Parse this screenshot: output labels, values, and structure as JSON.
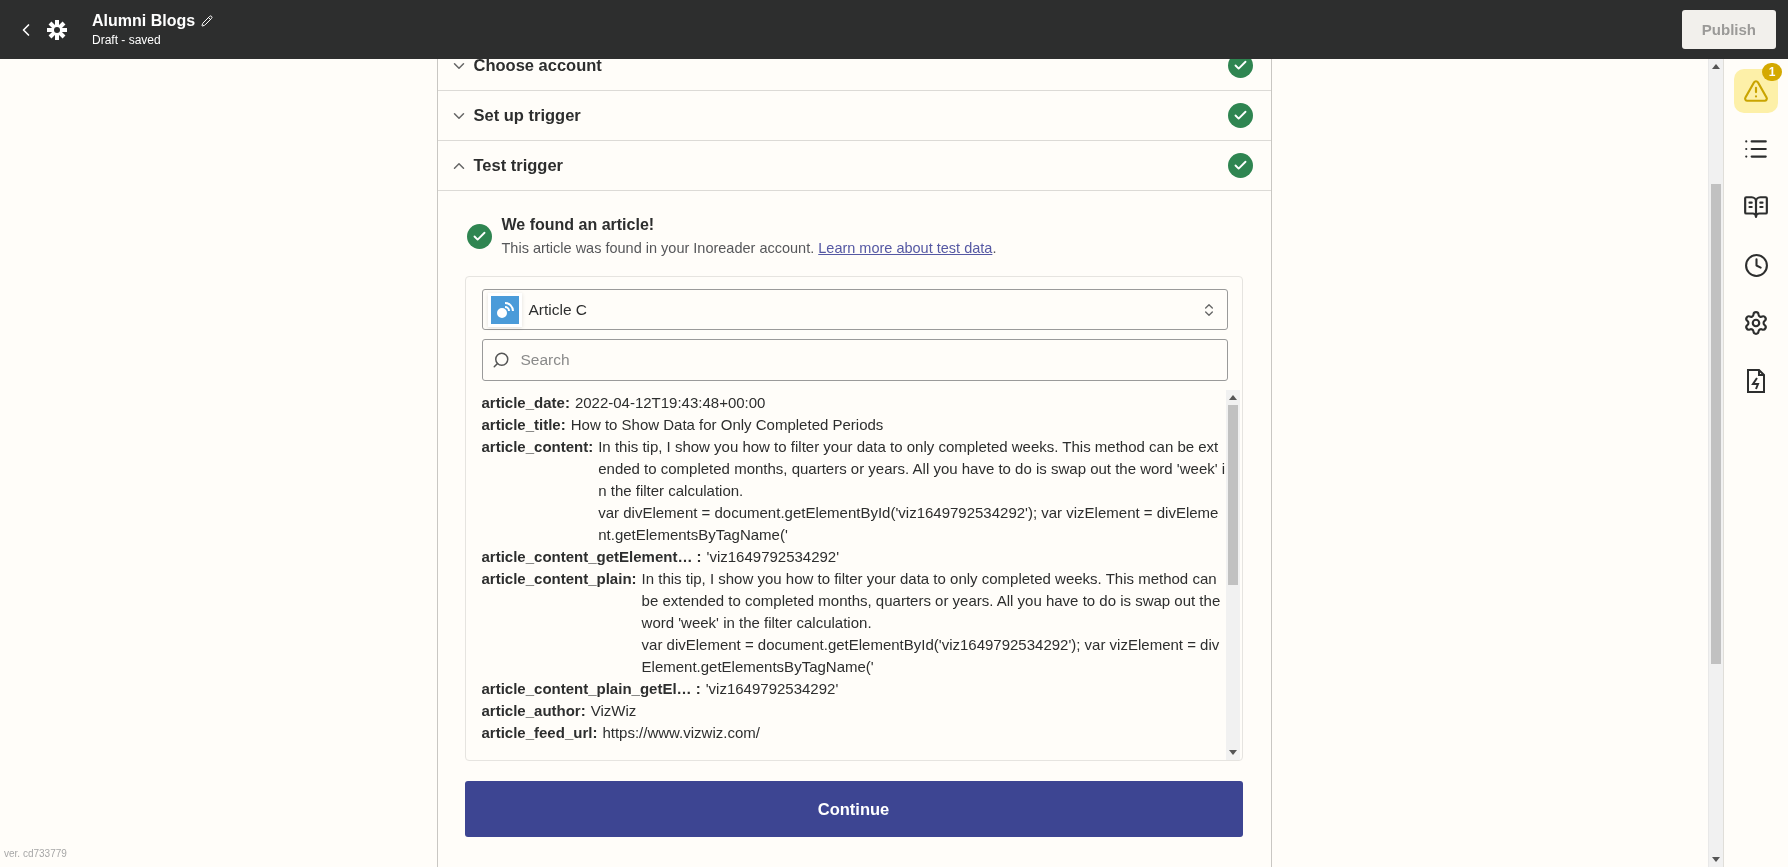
{
  "header": {
    "title": "Alumni Blogs",
    "subtitle": "Draft - saved",
    "publish_button": {
      "label": "Publish",
      "disabled": true
    }
  },
  "steps": [
    {
      "title": "Choose account",
      "expanded": false,
      "complete": true
    },
    {
      "title": "Set up trigger",
      "expanded": false,
      "complete": true
    },
    {
      "title": "Test trigger",
      "expanded": true,
      "complete": true
    }
  ],
  "result": {
    "title": "We found an article!",
    "text": "This article was found in your Inoreader account. ",
    "link": "Learn more about test data",
    "text_after": "."
  },
  "record_select": {
    "value": "Article C"
  },
  "search": {
    "placeholder": "Search"
  },
  "fields": [
    {
      "key": "article_date:",
      "paragraphs": [
        "2022-04-12T19:43:48+00:00"
      ]
    },
    {
      "key": "article_title:",
      "paragraphs": [
        "How to Show Data for Only Completed Periods"
      ]
    },
    {
      "key": "article_content:",
      "paragraphs": [
        "In this tip, I show you how to filter your data to only completed weeks. This method can be extended to completed months, quarters or years. All you have to do is swap out the word 'week' in the filter calculation.",
        "var divElement = document.getElementById('viz1649792534292'); var vizElement = divElement.getElementsByTagName('"
      ]
    },
    {
      "key": "article_content_getElement… :",
      "paragraphs": [
        "'viz1649792534292'"
      ]
    },
    {
      "key": "article_content_plain:",
      "paragraphs": [
        "In this tip, I show you how to filter your data to only completed weeks. This method can be extended to completed months, quarters or years. All you have to do is swap out the word 'week' in the filter calculation.",
        "var divElement = document.getElementById('viz1649792534292'); var vizElement = divElement.getElementsByTagName('"
      ]
    },
    {
      "key": "article_content_plain_getEl… :",
      "paragraphs": [
        "'viz1649792534292'"
      ]
    },
    {
      "key": "article_author:",
      "paragraphs": [
        "VizWiz"
      ]
    },
    {
      "key": "article_feed_url:",
      "paragraphs": [
        "https://www.vizwiz.com/"
      ]
    }
  ],
  "continue_button": {
    "label": "Continue"
  },
  "version": "ver. cd733779",
  "sidebar": [
    {
      "kind": "warning",
      "selected": true,
      "badge": "1"
    },
    {
      "kind": "outline",
      "selected": false
    },
    {
      "kind": "guide",
      "selected": false
    },
    {
      "kind": "history",
      "selected": false
    },
    {
      "kind": "settings",
      "selected": false
    },
    {
      "kind": "file",
      "selected": false
    }
  ]
}
